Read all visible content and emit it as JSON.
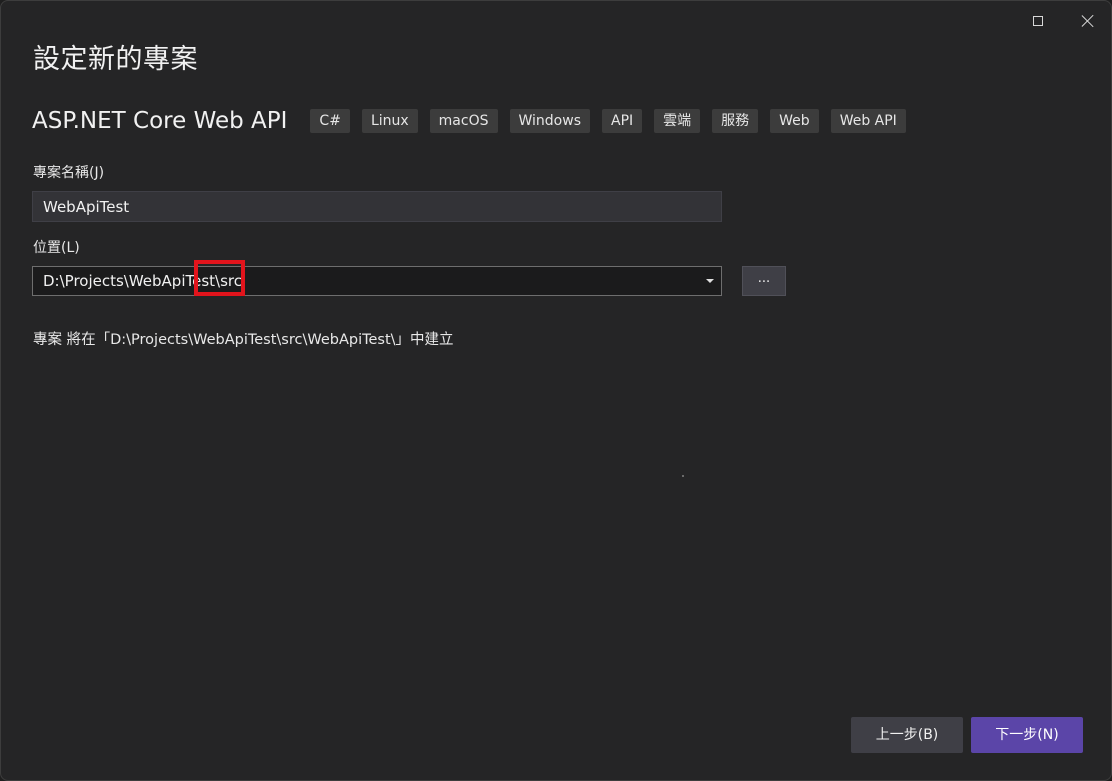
{
  "window": {
    "title": "設定新的專案",
    "maximize_icon": "maximize-icon",
    "close_icon": "close-icon"
  },
  "template": {
    "name": "ASP.NET Core Web API",
    "tags": [
      "C#",
      "Linux",
      "macOS",
      "Windows",
      "API",
      "雲端",
      "服務",
      "Web",
      "Web API"
    ]
  },
  "project_name": {
    "label": "專案名稱(J)",
    "value": "WebApiTest"
  },
  "location": {
    "label": "位置(L)",
    "value": "D:\\Projects\\WebApiTest\\src",
    "browse_label": "...",
    "highlight_color": "#e2141c"
  },
  "creation_info": "專案 將在「D:\\Projects\\WebApiTest\\src\\WebApiTest\\」中建立",
  "footer": {
    "back_label": "上一步(B)",
    "next_label": "下一步(N)",
    "next_color": "#5b45a8"
  }
}
